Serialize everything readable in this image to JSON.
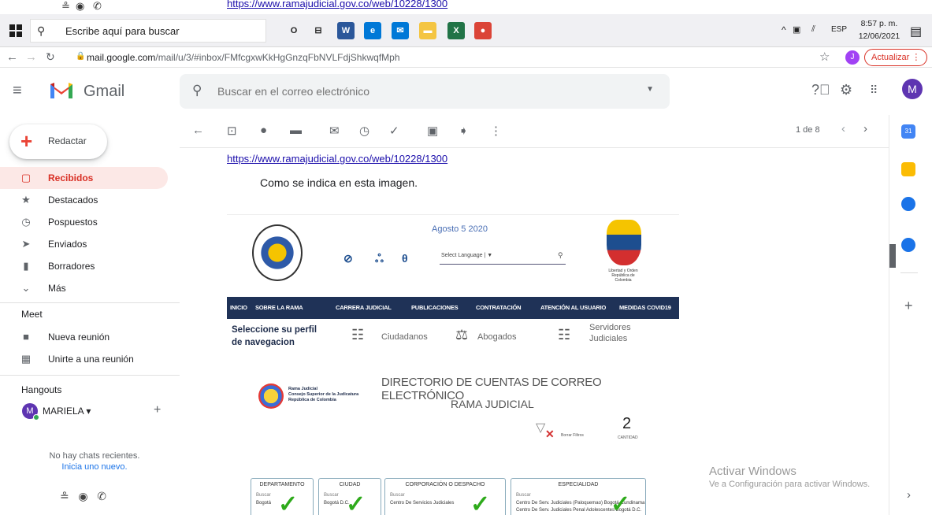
{
  "ghost": {
    "link": "https://www.ramajudicial.gov.co/web/10228/1300"
  },
  "taskbar": {
    "search_placeholder": "Escribe aquí para buscar",
    "tray_lang": "ESP",
    "clock_time": "8:57 p. m.",
    "clock_date": "12/06/2021",
    "apps": [
      {
        "name": "cortana-icon",
        "glyph": "O",
        "color": "#222"
      },
      {
        "name": "task-view-icon",
        "glyph": "⊟",
        "color": "#222"
      },
      {
        "name": "word-icon",
        "glyph": "W",
        "color": "#2b579a"
      },
      {
        "name": "edge-icon",
        "glyph": "e",
        "color": "#0078d7"
      },
      {
        "name": "mail-icon",
        "glyph": "✉",
        "color": "#0078d7"
      },
      {
        "name": "file-explorer-icon",
        "glyph": "▬",
        "color": "#f4c542"
      },
      {
        "name": "excel-icon",
        "glyph": "X",
        "color": "#217346"
      },
      {
        "name": "chrome-icon",
        "glyph": "●",
        "color": "#db4437"
      }
    ]
  },
  "browser": {
    "url_host": "mail.google.com",
    "url_path": "/mail/u/3/#inbox/FMfcgxwKkHgGnzqFbNVLFdjShkwqfMph",
    "profile_initial": "J",
    "update_label": "Actualizar"
  },
  "gmail": {
    "title": "Gmail",
    "search_placeholder": "Buscar en el correo electrónico",
    "avatar": "M",
    "compose_label": "Redactar",
    "nav": [
      {
        "label": "Recibidos",
        "icon": "inbox-icon",
        "glyph": "▢",
        "active": true
      },
      {
        "label": "Destacados",
        "icon": "star-icon",
        "glyph": "★",
        "active": false
      },
      {
        "label": "Pospuestos",
        "icon": "clock-icon",
        "glyph": "◷",
        "active": false
      },
      {
        "label": "Enviados",
        "icon": "send-icon",
        "glyph": "➤",
        "active": false
      },
      {
        "label": "Borradores",
        "icon": "draft-icon",
        "glyph": "▮",
        "active": false
      },
      {
        "label": "Más",
        "icon": "chevron-down-icon",
        "glyph": "⌄",
        "active": false
      }
    ],
    "meet": {
      "title": "Meet",
      "new_meeting": "Nueva reunión",
      "join_meeting": "Unirte a una reunión"
    },
    "hangouts": {
      "title": "Hangouts",
      "user": "MARIELA",
      "user_initial": "M",
      "no_chats": "No hay chats recientes.",
      "start_new": "Inicia uno nuevo."
    },
    "pager": "1 de 8"
  },
  "message": {
    "link": "https://www.ramajudicial.gov.co/web/10228/1300",
    "text": "Como se indica en esta imagen."
  },
  "embedded": {
    "date": "Agosto 5 2020",
    "select_language": "Select Language | ▼",
    "coat_caption": "Libertad y Orden\nRepública de Colombia",
    "nav": [
      "INICIO",
      "SOBRE LA RAMA",
      "CARRERA JUDICIAL",
      "PUBLICACIONES",
      "CONTRATACIÓN",
      "ATENCIÓN AL USUARIO",
      "MEDIDAS COVID19"
    ],
    "profile_title": "Seleccione su perfil de navegacion",
    "profiles": [
      "Ciudadanos",
      "Abogados",
      "Servidores Judiciales"
    ],
    "dir_logo_text": "Rama Judicial\nConsejo Superior de la Judicatura\nRepública de Colombia",
    "dir_title1": "DIRECTORIO DE CUENTAS DE CORREO ELECTRÓNICO",
    "dir_title2": "RAMA JUDICIAL",
    "filter_label": "Borrar Filtros",
    "count_value": "2",
    "count_label": "CANTIDAD",
    "filters": [
      {
        "header": "DEPARTAMENTO",
        "search": "Buscar",
        "options": [
          "Bogotá"
        ]
      },
      {
        "header": "CIUDAD",
        "search": "Buscar",
        "options": [
          "Bogotá D.C."
        ]
      },
      {
        "header": "CORPORACIÓN O DESPACHO",
        "search": "Buscar",
        "options": [
          "Centro De Servicios Judiciales"
        ]
      },
      {
        "header": "ESPECIALIDAD",
        "search": "Buscar",
        "options": [
          "Centro De Serv. Judiciales (Paloquemao) Bogotá-Cundinama",
          "Centro De Serv. Judiciales Penal Adolescentes Bogotá D.C."
        ]
      }
    ]
  },
  "windows_watermark": {
    "title": "Activar Windows",
    "subtitle": "Ve a Configuración para activar Windows."
  }
}
